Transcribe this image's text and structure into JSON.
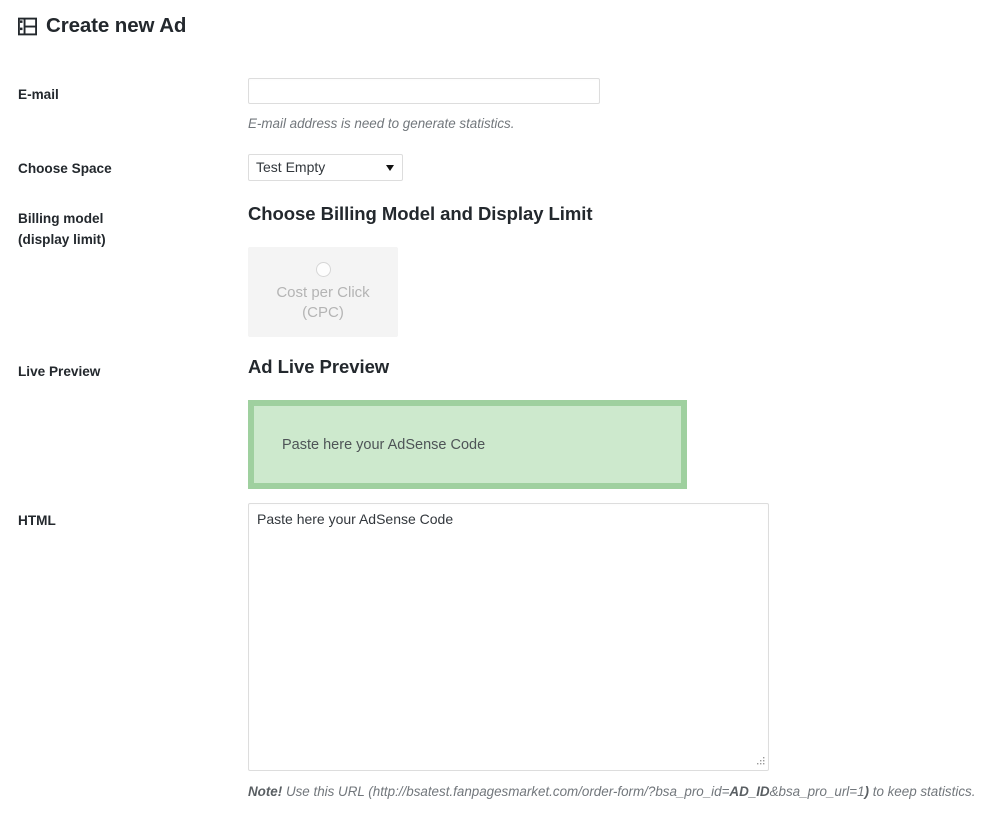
{
  "page": {
    "title": "Create new Ad",
    "title_icon": "layout-table-icon"
  },
  "fields": {
    "email": {
      "label": "E-mail",
      "value": "",
      "placeholder": "",
      "help": "E-mail address is need to generate statistics."
    },
    "space": {
      "label": "Choose Space",
      "selected": "Test Empty",
      "options": [
        "Test Empty"
      ],
      "dropdown_icon": "chevron-down-icon"
    },
    "billing": {
      "label_line1": "Billing model",
      "label_line2": "(display limit)",
      "heading": "Choose Billing Model and Display Limit",
      "options": [
        {
          "id": "cpc",
          "line1": "Cost per Click",
          "line2": "(CPC)",
          "selected": false,
          "radio_icon": "radio-unchecked-icon"
        }
      ]
    },
    "preview": {
      "label": "Live Preview",
      "heading": "Ad Live Preview",
      "content": "Paste here your AdSense Code",
      "fill_color": "#cde9cd",
      "border_color": "#9fd09f"
    },
    "html": {
      "label": "HTML",
      "value": "Paste here your AdSense Code",
      "resize_icon": "resize-grip-icon"
    }
  },
  "footer": {
    "note_label": "Note!",
    "note_text_before": " Use this URL (http://bsatest.fanpagesmarket.com/order-form/?bsa_pro_id=",
    "note_bold": "AD_ID",
    "note_text_mid": "&bsa_pro_url=1",
    "note_bold2": ")",
    "note_text_after": " to keep statistics."
  }
}
